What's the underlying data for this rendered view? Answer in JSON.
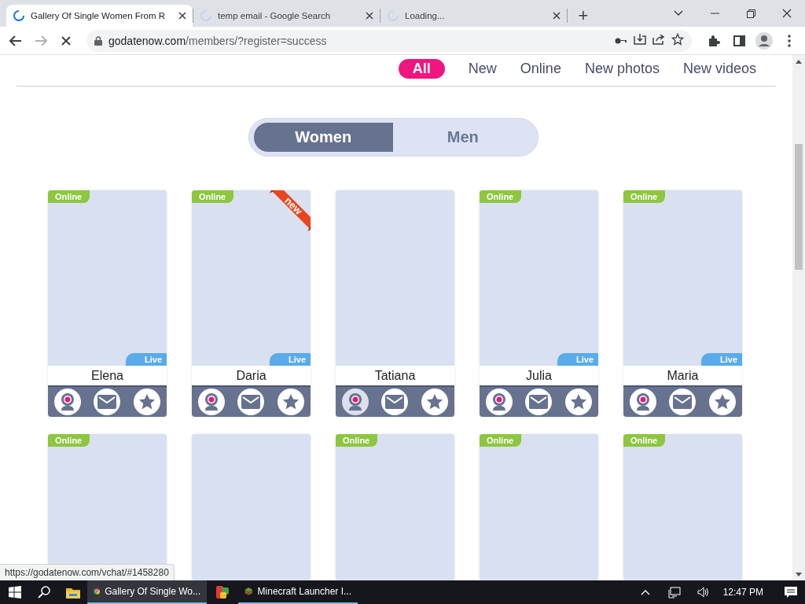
{
  "browser": {
    "tabs": [
      {
        "title": "Gallery Of Single Women From R",
        "selected": true
      },
      {
        "title": "temp email - Google Search",
        "selected": false
      },
      {
        "title": "Loading...",
        "selected": false
      }
    ],
    "new_tab": "+",
    "address": {
      "domain": "godatenow.com",
      "path": "/members/?register=success"
    }
  },
  "filters": [
    {
      "label": "All",
      "selected": true
    },
    {
      "label": "New",
      "selected": false
    },
    {
      "label": "Online",
      "selected": false
    },
    {
      "label": "New photos",
      "selected": false
    },
    {
      "label": "New videos",
      "selected": false
    }
  ],
  "gender": [
    {
      "label": "Women",
      "selected": true
    },
    {
      "label": "Men",
      "selected": false
    }
  ],
  "profiles": [
    {
      "kind": "full",
      "name": "Elena",
      "status_badge": "Online",
      "live_badge": "Live",
      "webcam_enabled": true
    },
    {
      "kind": "full",
      "name": "Daria",
      "status_badge": "Online",
      "live_badge": "Live",
      "ribbon": "new",
      "webcam_enabled": true
    },
    {
      "kind": "full",
      "name": "Tatiana",
      "webcam_enabled": false
    },
    {
      "kind": "full",
      "name": "Julia",
      "status_badge": "Online",
      "live_badge": "Live",
      "webcam_enabled": true
    },
    {
      "kind": "full",
      "name": "Maria",
      "status_badge": "Online",
      "live_badge": "Live",
      "webcam_enabled": true
    },
    {
      "kind": "cut",
      "status_badge": "Online"
    },
    {
      "kind": "cut"
    },
    {
      "kind": "cut",
      "status_badge": "Online"
    },
    {
      "kind": "cut",
      "status_badge": "Online"
    },
    {
      "kind": "cut",
      "status_badge": "Online"
    }
  ],
  "status_link": "https://godatenow.com/vchat/#1458280",
  "taskbar": {
    "apps": [
      {
        "kind": "browser",
        "label": "Gallery Of Single Wo...",
        "active": true
      },
      {
        "kind": "colorful",
        "active": false
      },
      {
        "kind": "minecraft",
        "label": "Minecraft Launcher I...",
        "active": false
      }
    ],
    "time": "12:47 PM"
  }
}
